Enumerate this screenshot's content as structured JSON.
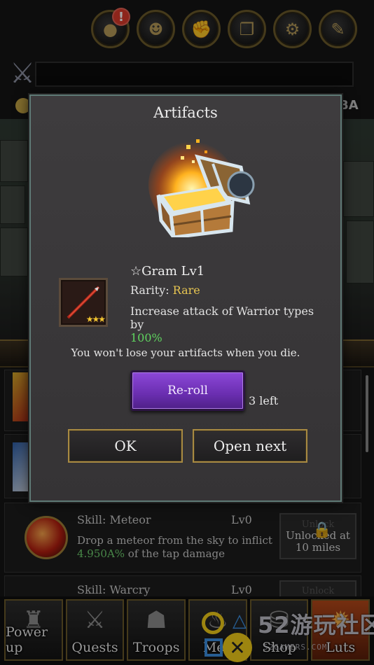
{
  "modal": {
    "title": "Artifacts",
    "artifact": {
      "name": "☆Gram Lv1",
      "rarity_label": "Rarity:",
      "rarity_value": "Rare",
      "stars": "★★★",
      "effect_text": "Increase attack of Warrior types by",
      "effect_value": "100%"
    },
    "note": "You won't lose your artifacts when you die.",
    "reroll_label": "Re-roll",
    "reroll_remaining": "3 left",
    "ok_label": "OK",
    "open_next_label": "Open next"
  },
  "background": {
    "header_partial": "BA",
    "skills": [
      {
        "title": "Skill: Meteor",
        "level": "Lv0",
        "desc_before": "Drop a meteor from the sky to inflict ",
        "desc_value": "4.950A%",
        "desc_after": " of the tap damage",
        "lock_ghost": "Unlock",
        "lock_text": "Unlocked at 10 miles"
      },
      {
        "title": "Skill: Warcry",
        "level": "Lv0",
        "lock_ghost": "Unlock"
      }
    ],
    "nav": [
      {
        "label": "Power up",
        "icon": "warrior-banner-icon"
      },
      {
        "label": "Quests",
        "icon": "sword-icon"
      },
      {
        "label": "Troops",
        "icon": "knight-helmet-icon"
      },
      {
        "label": "Mea",
        "icon": "meat-icon"
      },
      {
        "label": "Shop",
        "icon": "shop-icon"
      },
      {
        "label": "Luts",
        "icon": "fire-icon"
      }
    ]
  },
  "watermark": {
    "text": "52游玩社区",
    "subtext": "52GAMERS.COM"
  },
  "colors": {
    "rarity_rare": "#e6c451",
    "effect_green": "#5fd35f",
    "reroll_purple": "#6a2eb0",
    "gold_border": "#a88a42",
    "modal_border": "#5f7a76"
  }
}
